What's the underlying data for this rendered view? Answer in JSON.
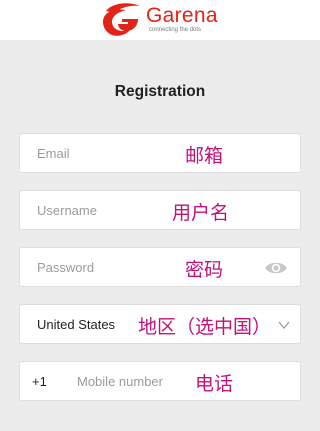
{
  "header": {
    "brand": "Garena",
    "tagline": "connecting the dots"
  },
  "page": {
    "title": "Registration"
  },
  "form": {
    "email": {
      "placeholder": "Email",
      "annotation": "邮箱"
    },
    "username": {
      "placeholder": "Username",
      "annotation": "用户名"
    },
    "password": {
      "placeholder": "Password",
      "annotation": "密码"
    },
    "region": {
      "value": "United States",
      "annotation": "地区（选中国）"
    },
    "phone": {
      "country_code": "+1",
      "placeholder": "Mobile number",
      "annotation": "电话"
    }
  },
  "colors": {
    "brand_red": "#e2231a",
    "annotation_magenta": "#c2127a"
  },
  "icons": {
    "password_toggle": "eye-icon",
    "region_dropdown": "chevron-down-icon"
  }
}
